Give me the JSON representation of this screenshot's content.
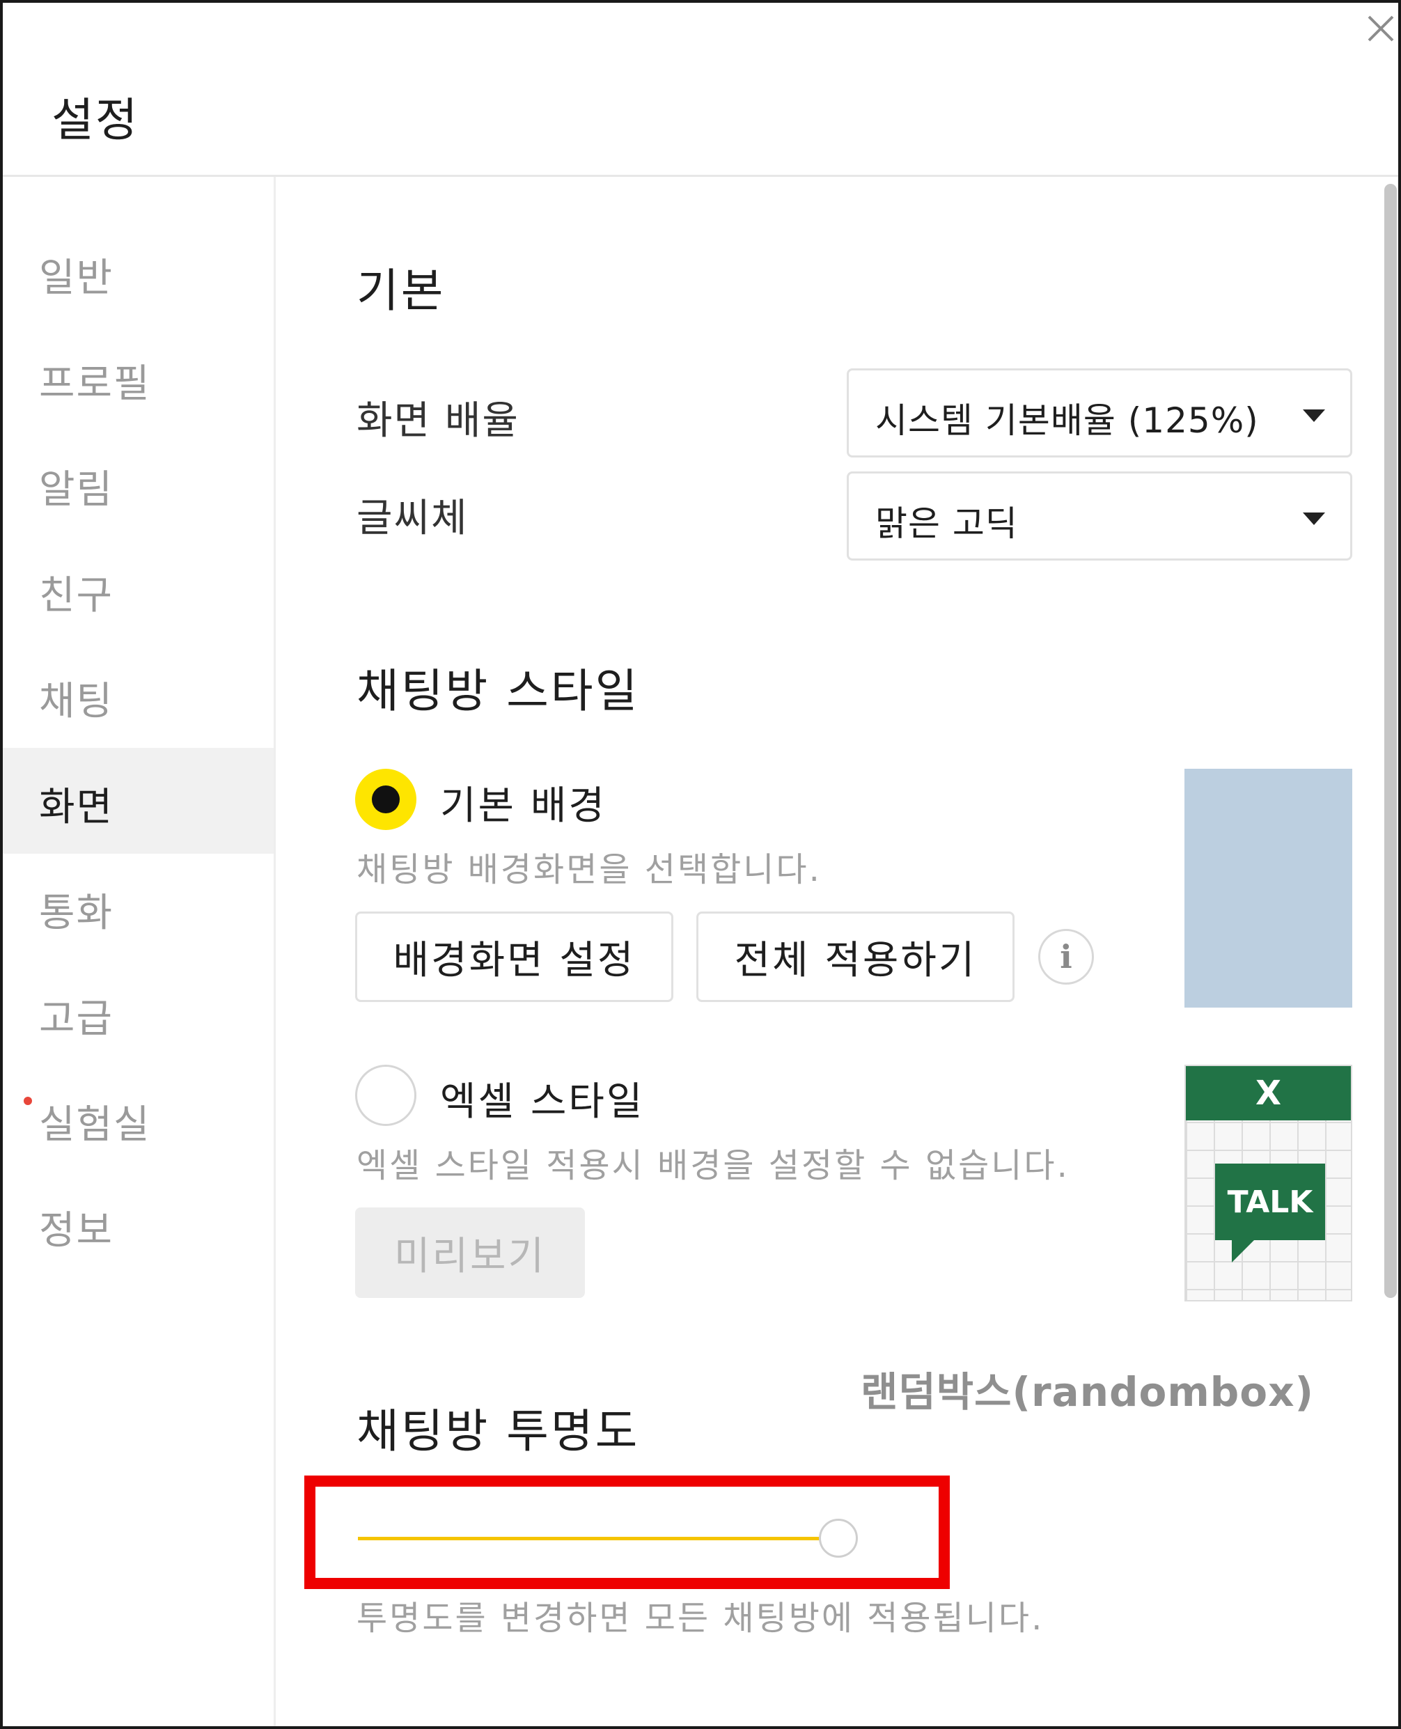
{
  "window": {
    "title": "설정",
    "close_icon": "close-icon"
  },
  "sidebar": {
    "items": [
      {
        "label": "일반",
        "active": false
      },
      {
        "label": "프로필",
        "active": false
      },
      {
        "label": "알림",
        "active": false
      },
      {
        "label": "친구",
        "active": false
      },
      {
        "label": "채팅",
        "active": false
      },
      {
        "label": "화면",
        "active": true
      },
      {
        "label": "통화",
        "active": false
      },
      {
        "label": "고급",
        "active": false
      },
      {
        "label": "실험실",
        "active": false,
        "new_dot": true
      },
      {
        "label": "정보",
        "active": false
      }
    ]
  },
  "basic": {
    "heading": "기본",
    "zoom": {
      "label": "화면 배율",
      "value": "시스템 기본배율 (125%)"
    },
    "font": {
      "label": "글씨체",
      "value": "맑은 고딕"
    }
  },
  "chat_style": {
    "heading": "채팅방 스타일",
    "default": {
      "label": "기본 배경",
      "selected": true,
      "desc": "채팅방 배경화면을 선택합니다.",
      "wallpaper_button": "배경화면 설정",
      "apply_all_button": "전체 적용하기",
      "info_icon": "i"
    },
    "excel": {
      "label": "엑셀 스타일",
      "selected": false,
      "desc": "엑셀 스타일 적용시 배경을 설정할 수 없습니다.",
      "preview_button": "미리보기",
      "thumb_header": "X",
      "thumb_badge": "TALK"
    },
    "colors": {
      "preview_blue": "#bccfe0",
      "excel_green": "#217346",
      "radio_on": "#fee500"
    }
  },
  "watermark": "랜덤박스(randombox)",
  "transparency": {
    "heading": "채팅방 투명도",
    "value_fraction": 1.0,
    "desc": "투명도를 변경하면 모든 채팅방에 적용됩니다.",
    "slider_color": "#f5c400",
    "highlight_color": "#ee0000"
  }
}
